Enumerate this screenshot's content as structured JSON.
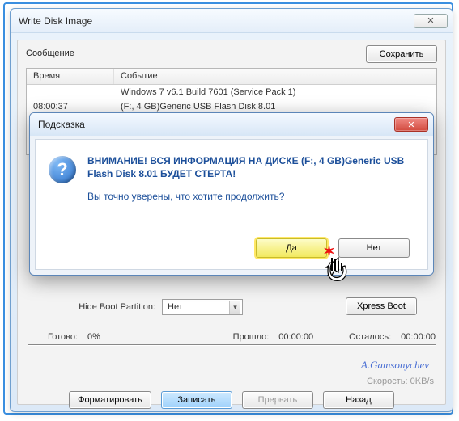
{
  "window": {
    "title": "Write Disk Image",
    "close_glyph": "✕"
  },
  "msg_label": "Сообщение",
  "save_btn": "Сохранить",
  "log": {
    "col_time": "Время",
    "col_event": "Событие",
    "rows": [
      {
        "time": "",
        "event": "Windows 7 v6.1 Build 7601 (Service Pack 1)"
      },
      {
        "time": "08:00:37",
        "event": "(F:, 4 GB)Generic USB Flash Disk  8.01"
      }
    ]
  },
  "hide_boot": {
    "label": "Hide Boot Partition:",
    "value": "Нет"
  },
  "xpress_btn": "Xpress Boot",
  "progress": {
    "ready": "Готово:",
    "pct": "0%",
    "elapsed": "Прошло:",
    "elapsed_v": "00:00:00",
    "remain": "Осталось:",
    "remain_v": "00:00:00"
  },
  "speed": {
    "label": "Скорость:",
    "value": "0KB/s"
  },
  "watermark": "A.Gamsonychev",
  "buttons": {
    "format": "Форматировать",
    "write": "Записать",
    "abort": "Прервать",
    "back": "Назад"
  },
  "dialog": {
    "title": "Подсказка",
    "icon": "?",
    "warn1": "ВНИМАНИЕ! ВСЯ ИНФОРМАЦИЯ НА ДИСКЕ (F:, 4 GB)Generic USB Flash Disk 8.01 БУДЕТ СТЕРТА!",
    "question": "Вы точно уверены, что хотите продолжить?",
    "yes": "Да",
    "no": "Нет",
    "close_glyph": "✕"
  }
}
